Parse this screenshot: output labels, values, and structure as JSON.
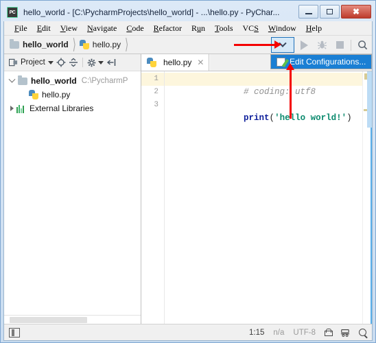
{
  "window": {
    "app_icon_label": "PC",
    "title": "hello_world - [C:\\PycharmProjects\\hello_world] - ...\\hello.py - PyChar...",
    "minimize_label": "–",
    "maximize_label": "□",
    "close_label": "✕"
  },
  "menubar": {
    "items": [
      {
        "pre": "",
        "mnemonic": "F",
        "post": "ile"
      },
      {
        "pre": "",
        "mnemonic": "E",
        "post": "dit"
      },
      {
        "pre": "",
        "mnemonic": "V",
        "post": "iew"
      },
      {
        "pre": "",
        "mnemonic": "N",
        "post": "avigate"
      },
      {
        "pre": "",
        "mnemonic": "C",
        "post": "ode"
      },
      {
        "pre": "",
        "mnemonic": "R",
        "post": "efactor"
      },
      {
        "pre": "R",
        "mnemonic": "u",
        "post": "n"
      },
      {
        "pre": "",
        "mnemonic": "T",
        "post": "ools"
      },
      {
        "pre": "VC",
        "mnemonic": "S",
        "post": ""
      },
      {
        "pre": "",
        "mnemonic": "W",
        "post": "indow"
      },
      {
        "pre": "",
        "mnemonic": "H",
        "post": "elp"
      }
    ]
  },
  "navbar": {
    "breadcrumbs": [
      {
        "label": "hello_world",
        "icon": "folder-icon",
        "bold": true
      },
      {
        "label": "hello.py",
        "icon": "python-file-icon",
        "bold": false
      }
    ],
    "separator": "〉",
    "run_tools": {
      "config_dropdown_label": "",
      "run_label": "",
      "debug_label": "",
      "stop_label": "",
      "search_label": ""
    }
  },
  "popup": {
    "item_label": "Edit Configurations...",
    "highlight_color": "#1a7fd4"
  },
  "annotations": {
    "arrow_color": "#f40000",
    "horizontal_arrow_target": "config-dropdown-button",
    "vertical_arrow_target": "edit-configurations-item"
  },
  "project_panel": {
    "toolbar": {
      "title": "Project",
      "locate_icon": "⊕",
      "collapse_icon": "═",
      "settings_icon": "⚙",
      "hide_icon": "⇤"
    },
    "tree": [
      {
        "label": "hello_world",
        "path": "C:\\PycharmP",
        "bold": true,
        "expanded": true,
        "icon": "folder-icon",
        "indent": 0
      },
      {
        "label": "hello.py",
        "path": "",
        "bold": false,
        "expanded": null,
        "icon": "python-file-icon",
        "indent": 1
      },
      {
        "label": "External Libraries",
        "path": "",
        "bold": false,
        "expanded": false,
        "icon": "library-icon",
        "indent": 0
      }
    ]
  },
  "editor": {
    "tab": {
      "label": "hello.py",
      "icon": "python-file-icon",
      "close_label": "✕"
    },
    "line_numbers": [
      "1",
      "2",
      "3"
    ],
    "lines": [
      {
        "current": true,
        "tokens": [
          {
            "type": "comment",
            "text": "# coding: utf8"
          }
        ]
      },
      {
        "current": false,
        "tokens": []
      },
      {
        "current": false,
        "tokens": [
          {
            "type": "kw",
            "text": "print"
          },
          {
            "type": "paren",
            "text": "("
          },
          {
            "type": "str",
            "text": "'hello world!'"
          },
          {
            "type": "paren",
            "text": ")"
          }
        ]
      }
    ]
  },
  "statusbar": {
    "layout_icon": "layout-toggle-icon",
    "caret_position": "1:15",
    "line_separator": "n/a",
    "encoding": "UTF-8",
    "lock_icon": "lock-icon",
    "git_icon": "☵",
    "search_icon": "magnifier-icon"
  }
}
